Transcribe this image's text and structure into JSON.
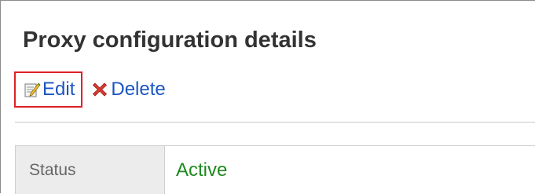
{
  "page": {
    "title": "Proxy configuration details"
  },
  "toolbar": {
    "edit_label": "Edit",
    "edit_icon": "edit-document-icon",
    "delete_label": "Delete",
    "delete_icon": "red-x-icon",
    "highlight_color": "#e0202a",
    "link_color": "#1a55c2"
  },
  "details": {
    "rows": [
      {
        "label": "Status",
        "value": "Active",
        "value_color": "#1e8a1e"
      }
    ]
  }
}
